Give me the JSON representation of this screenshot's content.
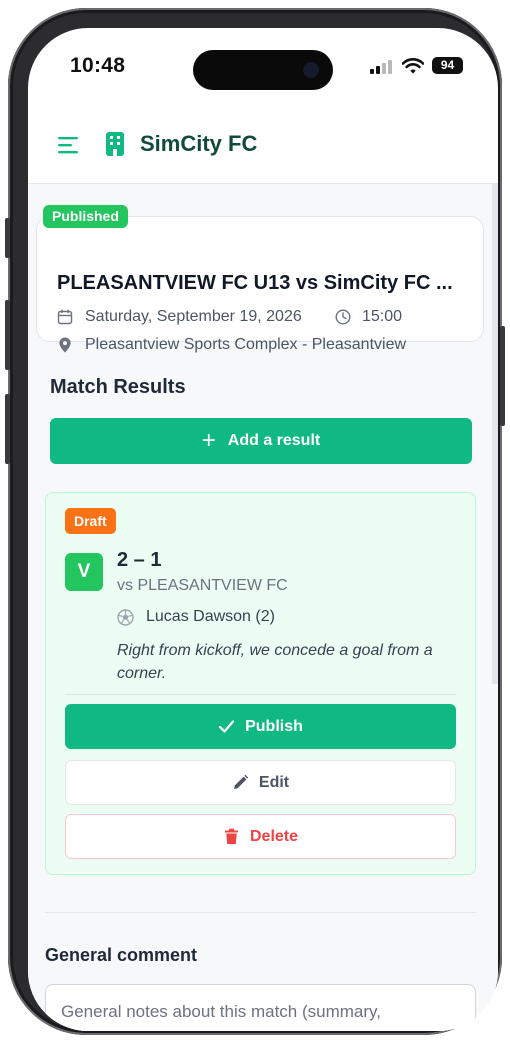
{
  "status_bar": {
    "time": "10:48",
    "battery": "94"
  },
  "app": {
    "title": "SimCity FC"
  },
  "match": {
    "status": "Published",
    "title": "PLEASANTVIEW FC U13 vs SimCity FC ...",
    "date": "Saturday, September 19, 2026",
    "time": "15:00",
    "location": "Pleasantview Sports Complex - Pleasantview"
  },
  "results": {
    "section_title": "Match Results",
    "add_label": "Add a result",
    "items": [
      {
        "status": "Draft",
        "outcome": "V",
        "score": "2 – 1",
        "opponent": "vs PLEASANTVIEW FC",
        "scorer": "Lucas Dawson (2)",
        "comment": "Right from kickoff, we concede a goal from a corner.",
        "publish_label": "Publish",
        "edit_label": "Edit",
        "delete_label": "Delete"
      }
    ]
  },
  "general_comment": {
    "title": "General comment",
    "placeholder": "General notes about this match (summary, atmosphere, areas to improve...)..."
  },
  "colors": {
    "primary": "#10b981",
    "success": "#22c55e",
    "draft": "#f97316",
    "danger": "#ef4444",
    "brand_text": "#114a3a"
  }
}
